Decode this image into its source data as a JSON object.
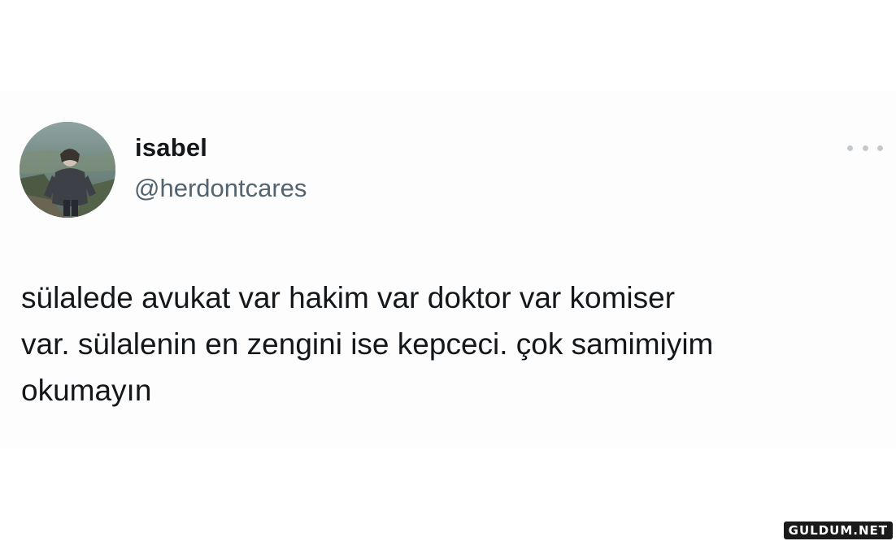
{
  "tweet": {
    "display_name": "isabel",
    "handle": "@herdontcares",
    "text_lines": [
      "sülalede avukat var hakim var doktor var komiser",
      "var. sülalenin en zengini ise kepceci. çok samimiyim",
      "okumayın"
    ],
    "avatar_icon": "profile-photo",
    "more_icon": "ellipsis-icon"
  },
  "watermark": {
    "text": "GULDUM.NET"
  },
  "colors": {
    "name": "#14171a",
    "handle": "#536471",
    "more_dots": "#c4c9cd",
    "background": "#ffffff"
  }
}
